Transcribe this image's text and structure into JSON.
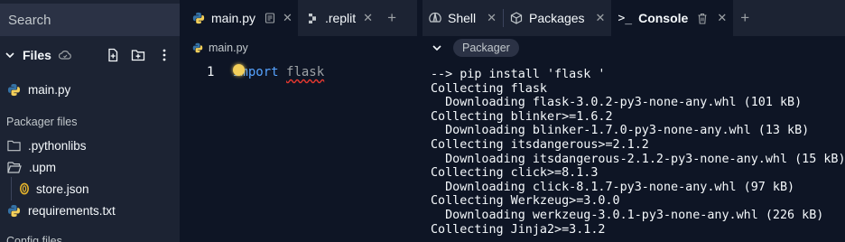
{
  "sidebar": {
    "search_placeholder": "Search",
    "files_title": "Files",
    "items": [
      {
        "label": "main.py"
      },
      {
        "label": ".pythonlibs"
      },
      {
        "label": ".upm"
      },
      {
        "label": "store.json"
      },
      {
        "label": "requirements.txt"
      }
    ],
    "section_packager": "Packager files",
    "section_config": "Config files"
  },
  "editor": {
    "tabs": [
      {
        "label": "main.py"
      },
      {
        "label": ".replit"
      }
    ],
    "breadcrumb": "main.py",
    "line_number": "1",
    "code_keyword": "import",
    "code_module": "flask"
  },
  "right_panel": {
    "tabs": [
      {
        "label": "Shell"
      },
      {
        "label": "Packages"
      },
      {
        "label": "Console"
      }
    ],
    "packager_label": "Packager",
    "console_lines": [
      "--> pip install 'flask '",
      "Collecting flask",
      "  Downloading flask-3.0.2-py3-none-any.whl (101 kB)",
      "Collecting blinker>=1.6.2",
      "  Downloading blinker-1.7.0-py3-none-any.whl (13 kB)",
      "Collecting itsdangerous>=2.1.2",
      "  Downloading itsdangerous-2.1.2-py3-none-any.whl (15 kB)",
      "Collecting click>=8.1.3",
      "  Downloading click-8.1.7-py3-none-any.whl (97 kB)",
      "Collecting Werkzeug>=3.0.0",
      "  Downloading werkzeug-3.0.1-py3-none-any.whl (226 kB)",
      "Collecting Jinja2>=3.1.2"
    ]
  },
  "colors": {
    "background": "#0e1525",
    "panel": "#1c2333",
    "keyword": "#56a3ff",
    "python_blue": "#3572a5",
    "python_yellow": "#f3cf5a",
    "error_underline": "#e5382f"
  }
}
